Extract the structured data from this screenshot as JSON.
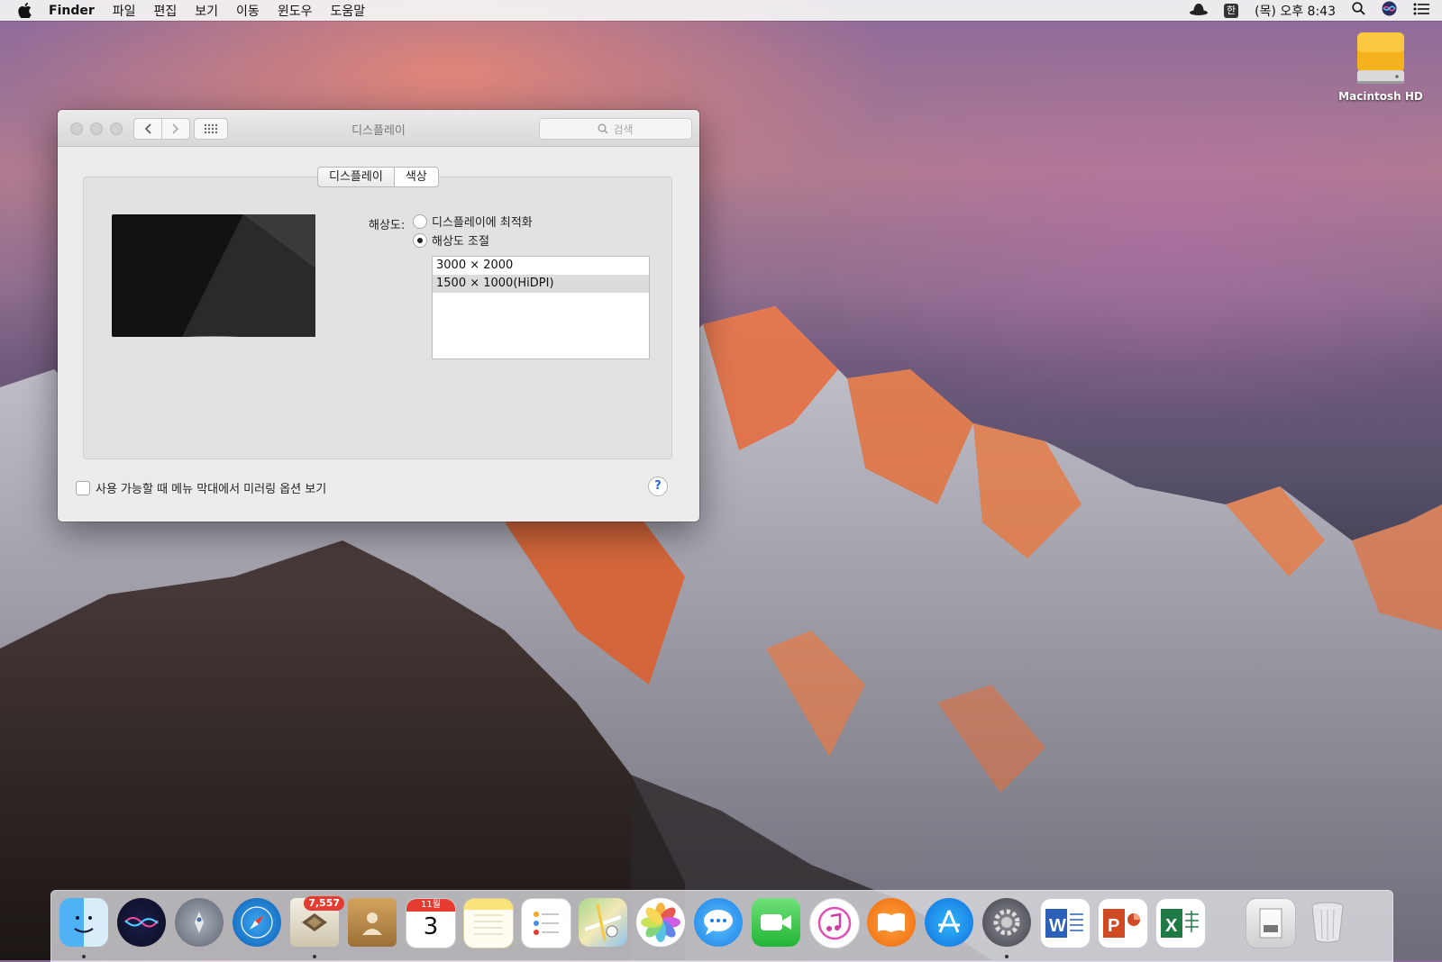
{
  "menubar": {
    "app": "Finder",
    "menus": [
      "파일",
      "편집",
      "보기",
      "이동",
      "윈도우",
      "도움말"
    ],
    "input_method": "한",
    "clock": "(목) 오후 8:43"
  },
  "desktop": {
    "hd_label": "Macintosh HD"
  },
  "window": {
    "title": "디스플레이",
    "search_placeholder": "검색",
    "tabs": [
      "디스플레이",
      "색상"
    ],
    "resolution_label": "해상도:",
    "options": [
      "디스플레이에 최적화",
      "해상도 조절"
    ],
    "selected_option": 1,
    "resolutions": [
      "3000 × 2000",
      "1500 × 1000(HiDPI)"
    ],
    "selected_resolution": 1,
    "mirror_label": "사용 가능할 때 메뉴 막대에서 미러링 옵션 보기",
    "help": "?"
  },
  "dock": {
    "mail_badge": "7,557",
    "calendar_month": "11월",
    "calendar_day": "3",
    "apps": [
      "finder",
      "siri",
      "launchpad",
      "safari",
      "mail",
      "contacts",
      "calendar",
      "notes",
      "reminders",
      "maps",
      "photos",
      "messages",
      "facetime",
      "itunes",
      "ibooks",
      "app-store",
      "system-preferences",
      "word",
      "powerpoint",
      "excel",
      "downloads",
      "trash"
    ]
  }
}
